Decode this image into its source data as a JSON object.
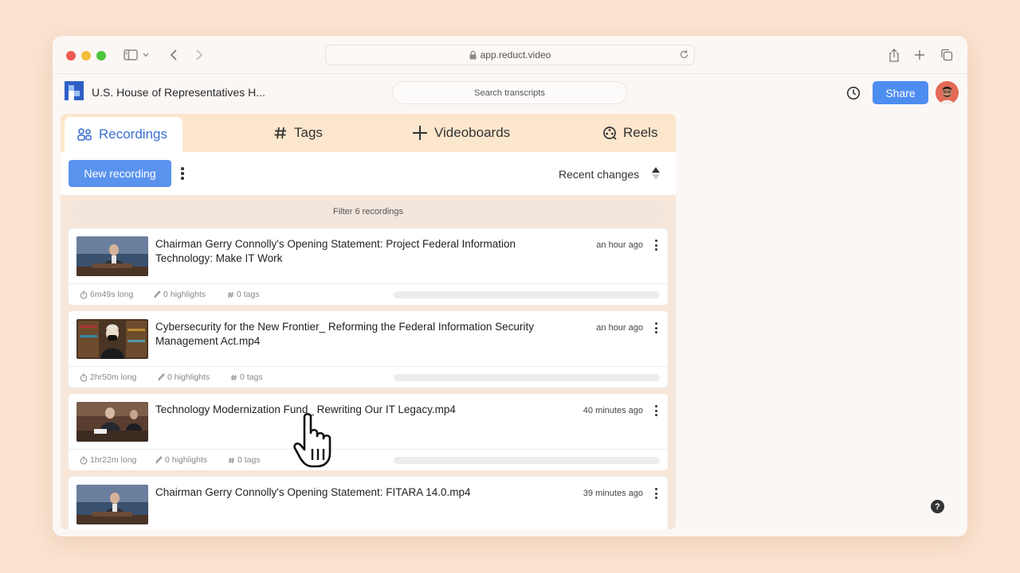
{
  "browser": {
    "url": "app.reduct.video"
  },
  "header": {
    "project_title": "U.S. House of Representatives H...",
    "search_placeholder": "Search transcripts",
    "share_label": "Share"
  },
  "tabs": [
    {
      "label": "Recordings",
      "icon": "people-icon",
      "active": true
    },
    {
      "label": "Tags",
      "icon": "hash-icon",
      "active": false
    },
    {
      "label": "Videoboards",
      "icon": "plus-icon",
      "active": false
    },
    {
      "label": "Reels",
      "icon": "reel-icon",
      "active": false
    }
  ],
  "toolbar": {
    "new_recording_label": "New recording",
    "sort_label": "Recent changes"
  },
  "filter": {
    "label": "Filter 6 recordings"
  },
  "recordings": [
    {
      "title": "Chairman Gerry Connolly's Opening Statement:   Project Federal Information Technology:   Make IT Work",
      "time": "an hour ago",
      "duration": "6m49s long",
      "highlights": "0 highlights",
      "tags": "0 tags",
      "progress": 0
    },
    {
      "title": "Cybersecurity for the New Frontier_ Reforming the Federal Information Security Management Act.mp4",
      "time": "an hour ago",
      "duration": "2hr50m long",
      "highlights": "0 highlights",
      "tags": "0 tags",
      "progress": 0
    },
    {
      "title": "Technology Modernization Fund_ Rewriting Our IT Legacy.mp4",
      "time": "40 minutes ago",
      "duration": "1hr22m long",
      "highlights": "0 highlights",
      "tags": "0 tags",
      "progress": 0
    },
    {
      "title": "Chairman Gerry Connolly's Opening Statement:   FITARA 14.0.mp4",
      "time": "39 minutes ago",
      "duration": "",
      "highlights": "",
      "tags": "",
      "progress": 0
    }
  ],
  "help": {
    "label": "?"
  },
  "colors": {
    "accent": "#4d8df0",
    "active_tab_text": "#3b6fd3",
    "tab_bar": "#fce6cd",
    "background": "#fbe3cf"
  }
}
